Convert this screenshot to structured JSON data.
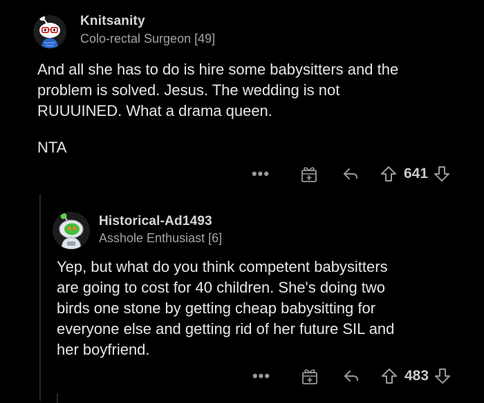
{
  "comments": [
    {
      "username": "Knitsanity",
      "flair": "Colo-rectal Surgeon [49]",
      "body_paragraph_1": "And all she has to do is hire some babysitters and the\nproblem is solved. Jesus. The wedding is not\nRUUUINED. What a drama queen.",
      "body_paragraph_2": "NTA",
      "score": "641",
      "avatar_icon": "snoo-avatar-glasses-icon"
    },
    {
      "username": "Historical-Ad1493",
      "flair": "Asshole Enthusiast [6]",
      "body": "Yep, but what do you think competent babysitters\nare going to cost for 40 children.  She's doing two\nbirds one stone by getting cheap babysitting for\neveryone else and getting rid of her future SIL and\nher boyfriend.",
      "score": "483",
      "avatar_icon": "snoo-avatar-astronaut-icon"
    }
  ],
  "actions": {
    "more_label": "•••"
  },
  "colors": {
    "background": "#000000",
    "text": "#e6e6e6",
    "muted": "#a3a3a3",
    "icon": "#9a9a9a"
  }
}
